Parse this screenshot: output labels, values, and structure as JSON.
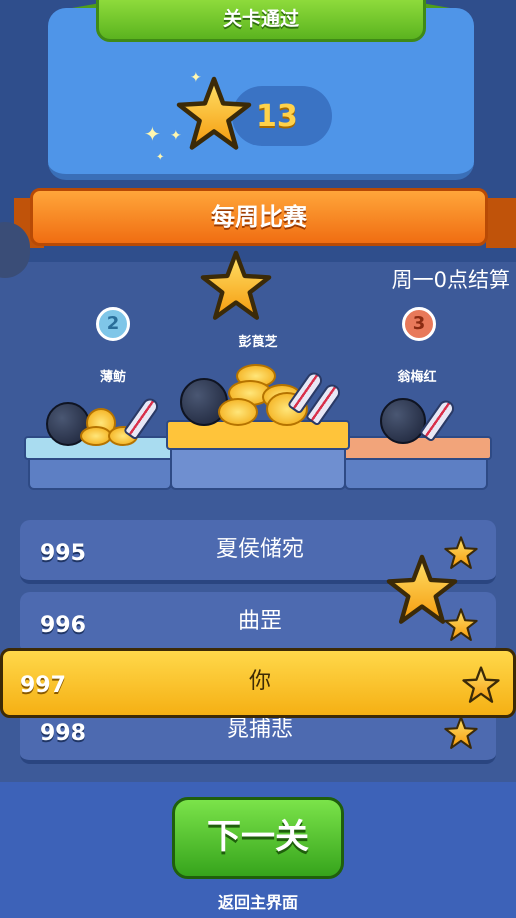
{
  "header": {
    "title": "关卡通过",
    "stars_earned": "13"
  },
  "weekly": {
    "title": "每周比赛",
    "settle_note": "周一0点结算"
  },
  "podium": [
    {
      "place": "2",
      "name": "薄鲂"
    },
    {
      "place": "1",
      "name": "彭莨芝"
    },
    {
      "place": "3",
      "name": "翁梅红"
    }
  ],
  "leaderboard": {
    "rows": [
      {
        "rank": "995",
        "name": "夏侯储宛"
      },
      {
        "rank": "996",
        "name": "曲罡"
      },
      {
        "rank": "997",
        "name": "你"
      },
      {
        "rank": "998",
        "name": "晁捕悲"
      }
    ]
  },
  "actions": {
    "next_label": "下一关",
    "back_label": "返回主界面"
  },
  "colors": {
    "background": "#2f4e8c",
    "accent_green": "#5bb31f",
    "accent_orange": "#f06d12",
    "highlight_yellow": "#f5b014"
  }
}
